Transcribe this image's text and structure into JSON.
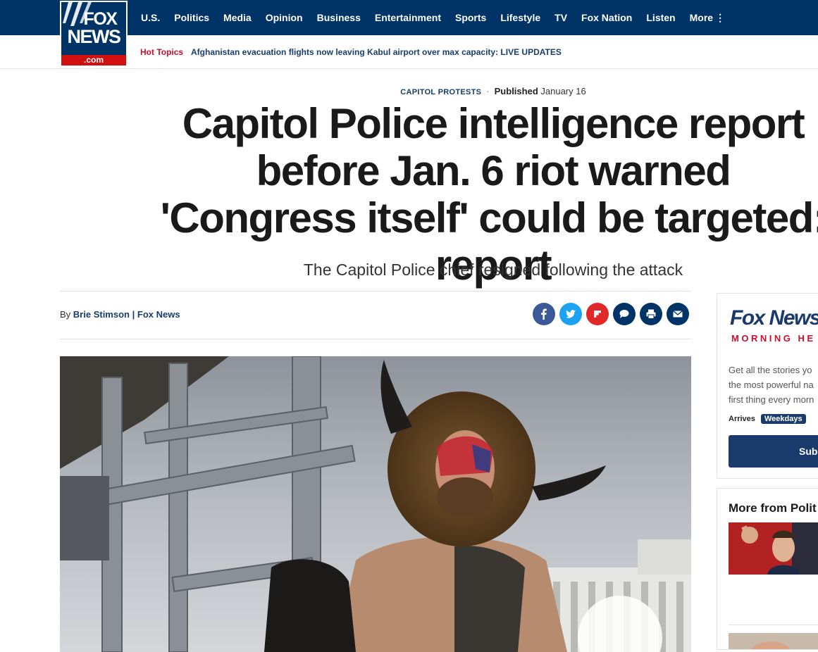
{
  "brand": {
    "logo_top": "FOX",
    "logo_bottom": "NEWS",
    "logo_domain": ".com"
  },
  "nav": {
    "items": [
      {
        "label": "U.S."
      },
      {
        "label": "Politics"
      },
      {
        "label": "Media"
      },
      {
        "label": "Opinion"
      },
      {
        "label": "Business"
      },
      {
        "label": "Entertainment"
      },
      {
        "label": "Sports"
      },
      {
        "label": "Lifestyle"
      },
      {
        "label": "TV"
      },
      {
        "label": "Fox Nation"
      },
      {
        "label": "Listen"
      },
      {
        "label": "More"
      }
    ]
  },
  "hot_topics": {
    "label": "Hot Topics",
    "link": "Afghanistan evacuation flights now leaving Kabul airport over max capacity: LIVE UPDATES"
  },
  "article": {
    "category": "CAPITOL PROTESTS",
    "published_label": "Published",
    "published_date": "January 16",
    "headline": "Capitol Police intelligence report before Jan. 6 riot warned 'Congress itself' could be targeted: report",
    "subhead": "The Capitol Police chief resigned following the attack",
    "byline_prefix": "By",
    "author": "Brie Stimson",
    "separator": "|",
    "source": "Fox News"
  },
  "share_icons": [
    {
      "name": "facebook-share-icon",
      "color": "#3b5998"
    },
    {
      "name": "twitter-share-icon",
      "color": "#1da1f2"
    },
    {
      "name": "flipboard-share-icon",
      "color": "#e12828"
    },
    {
      "name": "comments-icon",
      "color": "#003366"
    },
    {
      "name": "print-icon",
      "color": "#003366"
    },
    {
      "name": "email-icon",
      "color": "#003366"
    }
  ],
  "newsletter": {
    "brand": "Fox News",
    "subtitle": "MORNING HE",
    "desc_lines": [
      "Get all the stories yo",
      "the most powerful na",
      "first thing every morn"
    ],
    "arrives_label": "Arrives",
    "frequency": "Weekdays",
    "subscribe_label": "Subs"
  },
  "more_from": {
    "title": "More from Polit"
  },
  "colors": {
    "nav_bg": "#003366",
    "accent_red": "#c8102e",
    "link_blue": "#183c6b"
  }
}
